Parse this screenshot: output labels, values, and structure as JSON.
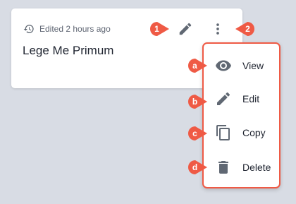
{
  "card": {
    "edited_text": "Edited 2 hours ago",
    "title": "Lege Me Primum"
  },
  "menu": {
    "items": [
      {
        "label": "View",
        "icon": "eye-icon"
      },
      {
        "label": "Edit",
        "icon": "pencil-icon"
      },
      {
        "label": "Copy",
        "icon": "copy-icon"
      },
      {
        "label": "Delete",
        "icon": "trash-icon"
      }
    ]
  },
  "callouts": {
    "edit": "1",
    "more": "2",
    "view": "a",
    "edit_item": "b",
    "copy": "c",
    "delete": "d"
  },
  "colors": {
    "accent": "#ef5a45",
    "icon": "#606873",
    "background": "#d8dce4"
  }
}
